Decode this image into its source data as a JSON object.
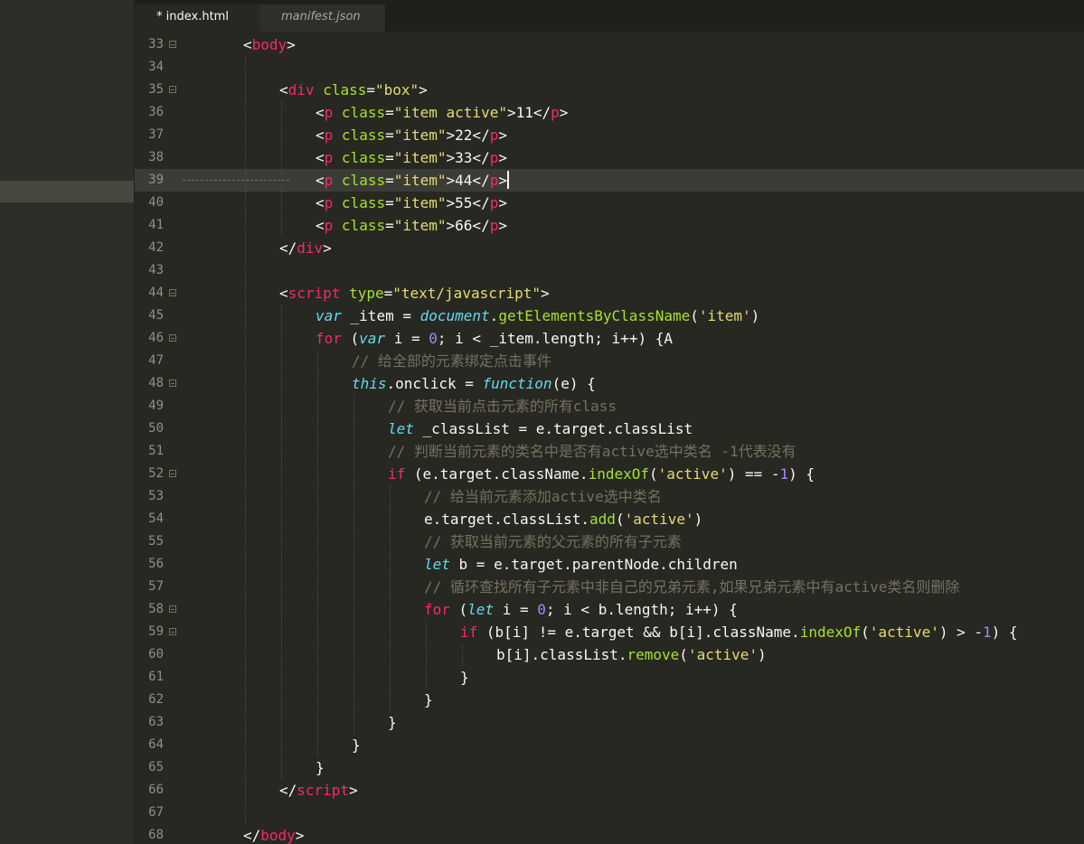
{
  "tabs": [
    {
      "label": "* index.html",
      "active": true
    },
    {
      "label": "manifest.json",
      "active": false
    }
  ],
  "current_line": 39,
  "colors": {
    "background": "#272822",
    "tag": "#f92672",
    "attribute": "#a6e22e",
    "string": "#e6db74",
    "storage": "#66d9ef",
    "number": "#ae81ff",
    "comment": "#75715e"
  },
  "lines": [
    {
      "n": "33",
      "indent": 1,
      "fold": true,
      "tokens": [
        [
          "text",
          "<"
        ],
        [
          "tag",
          "body"
        ],
        [
          "text",
          ">"
        ]
      ]
    },
    {
      "n": "34",
      "indent": 0,
      "fold": false,
      "tokens": []
    },
    {
      "n": "35",
      "indent": 2,
      "fold": true,
      "tokens": [
        [
          "text",
          "<"
        ],
        [
          "tag",
          "div"
        ],
        [
          "text",
          " "
        ],
        [
          "attr",
          "class"
        ],
        [
          "text",
          "="
        ],
        [
          "str",
          "\"box\""
        ],
        [
          "text",
          ">"
        ]
      ]
    },
    {
      "n": "36",
      "indent": 3,
      "fold": false,
      "tokens": [
        [
          "text",
          "<"
        ],
        [
          "tag",
          "p"
        ],
        [
          "text",
          " "
        ],
        [
          "attr",
          "class"
        ],
        [
          "text",
          "="
        ],
        [
          "str",
          "\"item active\""
        ],
        [
          "text",
          ">11</"
        ],
        [
          "tag",
          "p"
        ],
        [
          "text",
          ">"
        ]
      ]
    },
    {
      "n": "37",
      "indent": 3,
      "fold": false,
      "tokens": [
        [
          "text",
          "<"
        ],
        [
          "tag",
          "p"
        ],
        [
          "text",
          " "
        ],
        [
          "attr",
          "class"
        ],
        [
          "text",
          "="
        ],
        [
          "str",
          "\"item\""
        ],
        [
          "text",
          ">22</"
        ],
        [
          "tag",
          "p"
        ],
        [
          "text",
          ">"
        ]
      ]
    },
    {
      "n": "38",
      "indent": 3,
      "fold": false,
      "tokens": [
        [
          "text",
          "<"
        ],
        [
          "tag",
          "p"
        ],
        [
          "text",
          " "
        ],
        [
          "attr",
          "class"
        ],
        [
          "text",
          "="
        ],
        [
          "str",
          "\"item\""
        ],
        [
          "text",
          ">33</"
        ],
        [
          "tag",
          "p"
        ],
        [
          "text",
          ">"
        ]
      ]
    },
    {
      "n": "39",
      "indent": 3,
      "fold": false,
      "tokens": [
        [
          "text",
          "<"
        ],
        [
          "tag",
          "p"
        ],
        [
          "text",
          " "
        ],
        [
          "attr",
          "class"
        ],
        [
          "text",
          "="
        ],
        [
          "str",
          "\"item\""
        ],
        [
          "text",
          ">44</"
        ],
        [
          "tag",
          "p"
        ],
        [
          "text",
          ">"
        ]
      ]
    },
    {
      "n": "40",
      "indent": 3,
      "fold": false,
      "tokens": [
        [
          "text",
          "<"
        ],
        [
          "tag",
          "p"
        ],
        [
          "text",
          " "
        ],
        [
          "attr",
          "class"
        ],
        [
          "text",
          "="
        ],
        [
          "str",
          "\"item\""
        ],
        [
          "text",
          ">55</"
        ],
        [
          "tag",
          "p"
        ],
        [
          "text",
          ">"
        ]
      ]
    },
    {
      "n": "41",
      "indent": 3,
      "fold": false,
      "tokens": [
        [
          "text",
          "<"
        ],
        [
          "tag",
          "p"
        ],
        [
          "text",
          " "
        ],
        [
          "attr",
          "class"
        ],
        [
          "text",
          "="
        ],
        [
          "str",
          "\"item\""
        ],
        [
          "text",
          ">66</"
        ],
        [
          "tag",
          "p"
        ],
        [
          "text",
          ">"
        ]
      ]
    },
    {
      "n": "42",
      "indent": 2,
      "fold": false,
      "tokens": [
        [
          "text",
          "</"
        ],
        [
          "tag",
          "div"
        ],
        [
          "text",
          ">"
        ]
      ]
    },
    {
      "n": "43",
      "indent": 0,
      "fold": false,
      "tokens": []
    },
    {
      "n": "44",
      "indent": 2,
      "fold": true,
      "tokens": [
        [
          "text",
          "<"
        ],
        [
          "tag",
          "script"
        ],
        [
          "text",
          " "
        ],
        [
          "attr",
          "type"
        ],
        [
          "text",
          "="
        ],
        [
          "str",
          "\"text/javascript\""
        ],
        [
          "text",
          ">"
        ]
      ]
    },
    {
      "n": "45",
      "indent": 3,
      "fold": false,
      "tokens": [
        [
          "storage",
          "var"
        ],
        [
          "text",
          " _item = "
        ],
        [
          "builtin",
          "document"
        ],
        [
          "text",
          "."
        ],
        [
          "func",
          "getElementsByClassName"
        ],
        [
          "text",
          "("
        ],
        [
          "str",
          "'item'"
        ],
        [
          "text",
          ")"
        ]
      ]
    },
    {
      "n": "46",
      "indent": 3,
      "fold": true,
      "tokens": [
        [
          "kw",
          "for"
        ],
        [
          "text",
          " ("
        ],
        [
          "storage",
          "var"
        ],
        [
          "text",
          " i = "
        ],
        [
          "num",
          "0"
        ],
        [
          "text",
          "; i < _item.length; i++) {A"
        ]
      ]
    },
    {
      "n": "47",
      "indent": 4,
      "fold": false,
      "tokens": [
        [
          "comment",
          "// 给全部的元素绑定点击事件"
        ]
      ]
    },
    {
      "n": "48",
      "indent": 4,
      "fold": true,
      "tokens": [
        [
          "builtin",
          "this"
        ],
        [
          "text",
          ".onclick = "
        ],
        [
          "storage",
          "function"
        ],
        [
          "text",
          "(e) {"
        ]
      ]
    },
    {
      "n": "49",
      "indent": 5,
      "fold": false,
      "tokens": [
        [
          "comment",
          "// 获取当前点击元素的所有class"
        ]
      ]
    },
    {
      "n": "50",
      "indent": 5,
      "fold": false,
      "tokens": [
        [
          "storage",
          "let"
        ],
        [
          "text",
          " _classList = e.target.classList"
        ]
      ]
    },
    {
      "n": "51",
      "indent": 5,
      "fold": false,
      "tokens": [
        [
          "comment",
          "// 判断当前元素的类名中是否有active选中类名 -1代表没有"
        ]
      ]
    },
    {
      "n": "52",
      "indent": 5,
      "fold": true,
      "tokens": [
        [
          "kw",
          "if"
        ],
        [
          "text",
          " (e.target.className."
        ],
        [
          "func",
          "indexOf"
        ],
        [
          "text",
          "("
        ],
        [
          "str",
          "'active'"
        ],
        [
          "text",
          ") == -"
        ],
        [
          "num",
          "1"
        ],
        [
          "text",
          ") {"
        ]
      ]
    },
    {
      "n": "53",
      "indent": 6,
      "fold": false,
      "tokens": [
        [
          "comment",
          "// 给当前元素添加active选中类名"
        ]
      ]
    },
    {
      "n": "54",
      "indent": 6,
      "fold": false,
      "tokens": [
        [
          "text",
          "e.target.classList."
        ],
        [
          "func",
          "add"
        ],
        [
          "text",
          "("
        ],
        [
          "str",
          "'active'"
        ],
        [
          "text",
          ")"
        ]
      ]
    },
    {
      "n": "55",
      "indent": 6,
      "fold": false,
      "tokens": [
        [
          "comment",
          "// 获取当前元素的父元素的所有子元素"
        ]
      ]
    },
    {
      "n": "56",
      "indent": 6,
      "fold": false,
      "tokens": [
        [
          "storage",
          "let"
        ],
        [
          "text",
          " b = e.target.parentNode.children"
        ]
      ]
    },
    {
      "n": "57",
      "indent": 6,
      "fold": false,
      "tokens": [
        [
          "comment",
          "// 循环查找所有子元素中非自己的兄弟元素,如果兄弟元素中有active类名则删除"
        ]
      ]
    },
    {
      "n": "58",
      "indent": 6,
      "fold": true,
      "tokens": [
        [
          "kw",
          "for"
        ],
        [
          "text",
          " ("
        ],
        [
          "storage",
          "let"
        ],
        [
          "text",
          " i = "
        ],
        [
          "num",
          "0"
        ],
        [
          "text",
          "; i < b.length; i++) {"
        ]
      ]
    },
    {
      "n": "59",
      "indent": 7,
      "fold": true,
      "tokens": [
        [
          "kw",
          "if"
        ],
        [
          "text",
          " (b[i] != e.target && b[i].className."
        ],
        [
          "func",
          "indexOf"
        ],
        [
          "text",
          "("
        ],
        [
          "str",
          "'active'"
        ],
        [
          "text",
          ") > -"
        ],
        [
          "num",
          "1"
        ],
        [
          "text",
          ") {"
        ]
      ]
    },
    {
      "n": "60",
      "indent": 8,
      "fold": false,
      "tokens": [
        [
          "text",
          "b[i].classList."
        ],
        [
          "func",
          "remove"
        ],
        [
          "text",
          "("
        ],
        [
          "str",
          "'active'"
        ],
        [
          "text",
          ")"
        ]
      ]
    },
    {
      "n": "61",
      "indent": 7,
      "fold": false,
      "tokens": [
        [
          "text",
          "}"
        ]
      ]
    },
    {
      "n": "62",
      "indent": 6,
      "fold": false,
      "tokens": [
        [
          "text",
          "}"
        ]
      ]
    },
    {
      "n": "63",
      "indent": 5,
      "fold": false,
      "tokens": [
        [
          "text",
          "}"
        ]
      ]
    },
    {
      "n": "64",
      "indent": 4,
      "fold": false,
      "tokens": [
        [
          "text",
          "}"
        ]
      ]
    },
    {
      "n": "65",
      "indent": 3,
      "fold": false,
      "tokens": [
        [
          "text",
          "}"
        ]
      ]
    },
    {
      "n": "66",
      "indent": 2,
      "fold": false,
      "tokens": [
        [
          "text",
          "</"
        ],
        [
          "tag",
          "script"
        ],
        [
          "text",
          ">"
        ]
      ]
    },
    {
      "n": "67",
      "indent": 0,
      "fold": false,
      "tokens": []
    },
    {
      "n": "68",
      "indent": 1,
      "fold": false,
      "tokens": [
        [
          "text",
          "</"
        ],
        [
          "tag",
          "body"
        ],
        [
          "text",
          ">"
        ]
      ]
    }
  ]
}
